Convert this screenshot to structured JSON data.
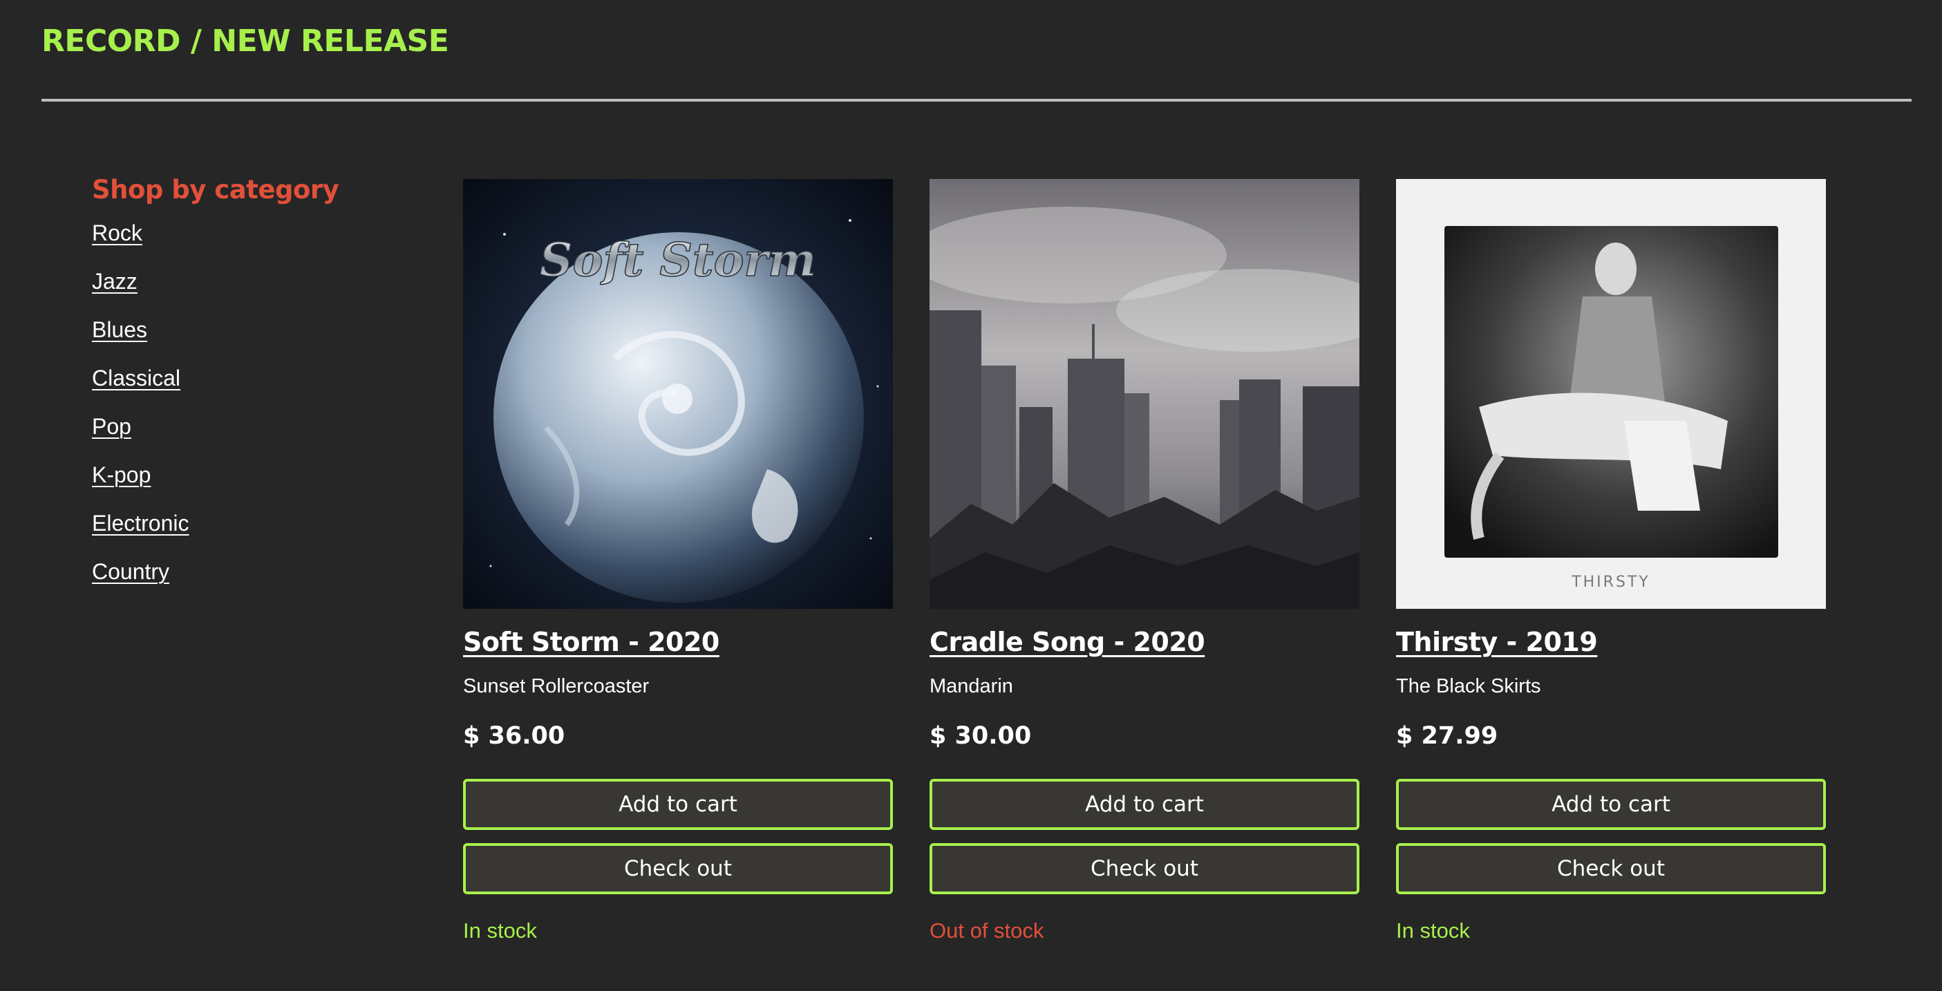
{
  "header": {
    "title": "RECORD / NEW RELEASE"
  },
  "sidebar": {
    "heading": "Shop by category",
    "categories": [
      "Rock",
      "Jazz",
      "Blues",
      "Classical",
      "Pop",
      "K-pop",
      "Electronic",
      "Country"
    ]
  },
  "products": [
    {
      "title": "Soft Storm - 2020",
      "artist": "Sunset Rollercoaster",
      "price": "$ 36.00",
      "add_label": "Add to cart",
      "checkout_label": "Check out",
      "stock": "In stock",
      "stock_color": "#a7f04c",
      "cover_text": "Soft Storm"
    },
    {
      "title": "Cradle Song - 2020",
      "artist": "Mandarin",
      "price": "$ 30.00",
      "add_label": "Add to cart",
      "checkout_label": "Check out",
      "stock": "Out of stock",
      "stock_color": "#e2503a"
    },
    {
      "title": "Thirsty - 2019",
      "artist": "The Black Skirts",
      "price": "$ 27.99",
      "add_label": "Add to cart",
      "checkout_label": "Check out",
      "stock": "In stock",
      "stock_color": "#a7f04c",
      "cover_text": "THIRSTY"
    }
  ],
  "colors": {
    "accent": "#a7f04c",
    "warning": "#e2503a",
    "background": "#262626"
  }
}
